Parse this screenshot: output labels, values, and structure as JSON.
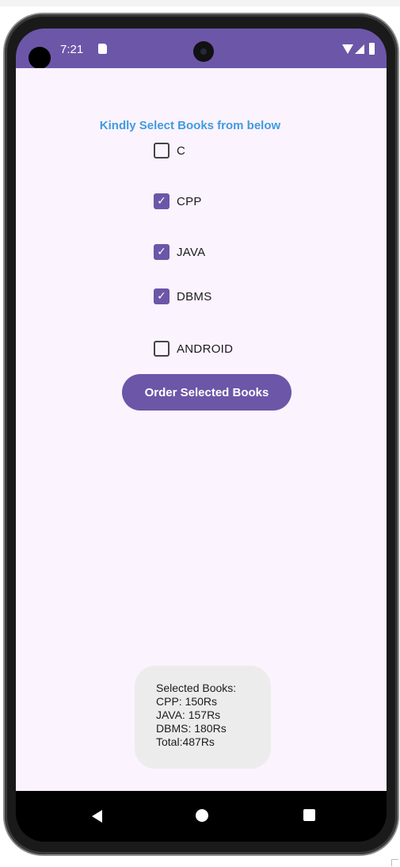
{
  "status_bar": {
    "time": "7:21"
  },
  "screen": {
    "heading": "Kindly Select Books from below",
    "checkboxes": [
      {
        "label": "C",
        "checked": false
      },
      {
        "label": "CPP",
        "checked": true
      },
      {
        "label": "JAVA",
        "checked": true
      },
      {
        "label": "DBMS",
        "checked": true
      },
      {
        "label": "ANDROID",
        "checked": false
      }
    ],
    "order_button_label": "Order Selected Books"
  },
  "toast": {
    "lines": [
      "Selected Books:",
      "CPP: 150Rs",
      "JAVA: 157Rs",
      "DBMS: 180Rs",
      "Total:487Rs"
    ]
  },
  "colors": {
    "accent": "#6c56a8",
    "heading_text": "#3f9be0",
    "background": "#fbf3fd",
    "toast_background": "#ececec"
  },
  "icons": [
    "sd-card-icon",
    "wifi-icon",
    "signal-icon",
    "battery-icon",
    "back-icon",
    "home-icon",
    "recents-icon"
  ]
}
